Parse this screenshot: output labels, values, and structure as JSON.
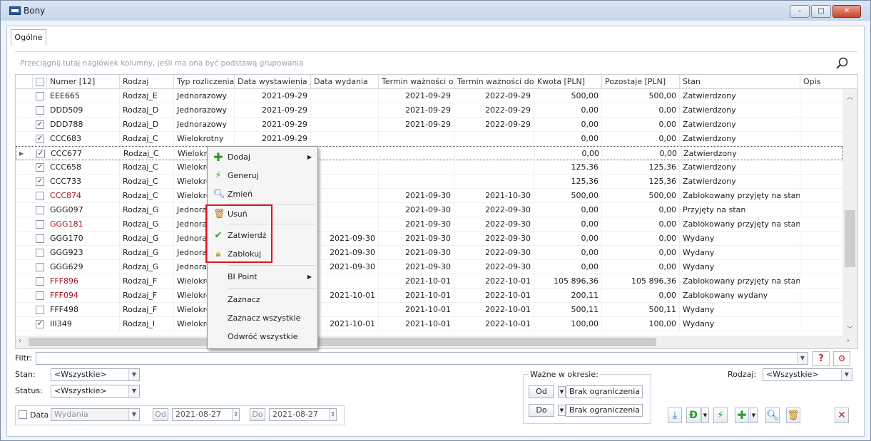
{
  "window": {
    "title": "Bony"
  },
  "tabs": [
    {
      "label": "Ogólne"
    }
  ],
  "group_hint": "Przeciągnij tutaj nagłówek kolumny, jeśli ma ona być podstawą grupowania",
  "columns": [
    "Numer [12]",
    "Rodzaj",
    "Typ rozliczenia",
    "Data wystawienia",
    "Data wydania",
    "Termin ważności od",
    "Termin ważności do",
    "Kwota [PLN]",
    "Pozostaje [PLN]",
    "Stan",
    "Opis"
  ],
  "sort_indicator": "▲",
  "rows": [
    {
      "checked": false,
      "numer": "EEE665",
      "rodzaj": "Rodzaj_E",
      "typ": "Jednorazowy",
      "data_wyst": "2021-09-29",
      "data_wyd": "",
      "od": "2021-09-29",
      "do": "2022-09-29",
      "kwota": "500,00",
      "pozostaje": "500,00",
      "stan": "Zatwierdzony",
      "red": false
    },
    {
      "checked": false,
      "numer": "DDD509",
      "rodzaj": "Rodzaj_D",
      "typ": "Jednorazowy",
      "data_wyst": "2021-09-29",
      "data_wyd": "",
      "od": "2021-09-29",
      "do": "2022-09-29",
      "kwota": "0,00",
      "pozostaje": "0,00",
      "stan": "Zatwierdzony",
      "red": false
    },
    {
      "checked": true,
      "numer": "DDD788",
      "rodzaj": "Rodzaj_D",
      "typ": "Jednorazowy",
      "data_wyst": "2021-09-29",
      "data_wyd": "",
      "od": "2021-09-29",
      "do": "2022-09-29",
      "kwota": "0,00",
      "pozostaje": "0,00",
      "stan": "Zatwierdzony",
      "red": false
    },
    {
      "checked": true,
      "numer": "CCC683",
      "rodzaj": "Rodzaj_C",
      "typ": "Wielokrotny",
      "data_wyst": "2021-09-29",
      "data_wyd": "",
      "od": "",
      "do": "",
      "kwota": "0,00",
      "pozostaje": "0,00",
      "stan": "Zatwierdzony",
      "red": false
    },
    {
      "checked": true,
      "numer": "CCC677",
      "rodzaj": "Rodzaj_C",
      "typ": "Wielokro",
      "data_wyst": "",
      "data_wyd": "",
      "od": "",
      "do": "",
      "kwota": "0,00",
      "pozostaje": "0,00",
      "stan": "Zatwierdzony",
      "red": false,
      "current": true
    },
    {
      "checked": true,
      "numer": "CCC658",
      "rodzaj": "Rodzaj_C",
      "typ": "Wielokro",
      "data_wyst": "",
      "data_wyd": "",
      "od": "",
      "do": "",
      "kwota": "125,36",
      "pozostaje": "125,36",
      "stan": "Zatwierdzony",
      "red": false
    },
    {
      "checked": true,
      "numer": "CCC733",
      "rodzaj": "Rodzaj_C",
      "typ": "Wielokro",
      "data_wyst": "",
      "data_wyd": "",
      "od": "",
      "do": "",
      "kwota": "125,36",
      "pozostaje": "125,36",
      "stan": "Zatwierdzony",
      "red": false
    },
    {
      "checked": false,
      "numer": "CCC874",
      "rodzaj": "Rodzaj_C",
      "typ": "Wielokro",
      "data_wyst": "",
      "data_wyd": "",
      "od": "2021-09-30",
      "do": "2021-10-30",
      "kwota": "500,00",
      "pozostaje": "500,00",
      "stan": "Zablokowany przyjęty na stan",
      "red": true
    },
    {
      "checked": false,
      "numer": "GGG097",
      "rodzaj": "Rodzaj_G",
      "typ": "Jednora",
      "data_wyst": "",
      "data_wyd": "",
      "od": "2021-09-30",
      "do": "2022-09-30",
      "kwota": "0,00",
      "pozostaje": "0,00",
      "stan": "Przyjęty na stan",
      "red": false
    },
    {
      "checked": false,
      "numer": "GGG181",
      "rodzaj": "Rodzaj_G",
      "typ": "Jednora",
      "data_wyst": "",
      "data_wyd": "",
      "od": "2021-09-30",
      "do": "2022-09-30",
      "kwota": "0,00",
      "pozostaje": "0,00",
      "stan": "Zablokowany przyjęty na stan",
      "red": true
    },
    {
      "checked": false,
      "numer": "GGG170",
      "rodzaj": "Rodzaj_G",
      "typ": "Jednora",
      "data_wyst": "",
      "data_wyd": "2021-09-30",
      "od": "2021-09-30",
      "do": "2022-09-30",
      "kwota": "0,00",
      "pozostaje": "0,00",
      "stan": "Wydany",
      "red": false
    },
    {
      "checked": false,
      "numer": "GGG923",
      "rodzaj": "Rodzaj_G",
      "typ": "Jednora",
      "data_wyst": "",
      "data_wyd": "2021-09-30",
      "od": "2021-09-30",
      "do": "2022-09-30",
      "kwota": "0,00",
      "pozostaje": "0,00",
      "stan": "Wydany",
      "red": false
    },
    {
      "checked": false,
      "numer": "GGG629",
      "rodzaj": "Rodzaj_G",
      "typ": "Jednora",
      "data_wyst": "",
      "data_wyd": "2021-09-30",
      "od": "2021-09-30",
      "do": "2022-09-30",
      "kwota": "0,00",
      "pozostaje": "0,00",
      "stan": "Wydany",
      "red": false
    },
    {
      "checked": false,
      "numer": "FFF896",
      "rodzaj": "Rodzaj_F",
      "typ": "Wielokro",
      "data_wyst": "",
      "data_wyd": "",
      "od": "2021-10-01",
      "do": "2022-10-01",
      "kwota": "105 896,36",
      "pozostaje": "105 896,36",
      "stan": "Zablokowany przyjęty na stan",
      "red": true
    },
    {
      "checked": false,
      "numer": "FFF094",
      "rodzaj": "Rodzaj_F",
      "typ": "Wielokro",
      "data_wyst": "",
      "data_wyd": "2021-10-01",
      "od": "2021-10-01",
      "do": "2022-10-01",
      "kwota": "200,11",
      "pozostaje": "0,00",
      "stan": "Zablokowany wydany",
      "red": true
    },
    {
      "checked": false,
      "numer": "FFF498",
      "rodzaj": "Rodzaj_F",
      "typ": "Wielokro",
      "data_wyst": "",
      "data_wyd": "",
      "od": "2021-10-01",
      "do": "2022-10-01",
      "kwota": "500,11",
      "pozostaje": "500,11",
      "stan": "Wydany",
      "red": false
    },
    {
      "checked": true,
      "numer": "III349",
      "rodzaj": "Rodzaj_I",
      "typ": "Wielokro",
      "data_wyst": "",
      "data_wyd": "2021-10-01",
      "od": "2021-10-01",
      "do": "2022-10-01",
      "kwota": "100,00",
      "pozostaje": "100,00",
      "stan": "Wydany",
      "red": false
    }
  ],
  "context_menu": [
    {
      "label": "Dodaj",
      "icon": "plus-icon",
      "submenu": true
    },
    {
      "label": "Generuj",
      "icon": "lightning-icon"
    },
    {
      "label": "Zmień",
      "icon": "magnifier-icon"
    },
    {
      "label": "Usuń",
      "icon": "trash-icon"
    },
    {
      "label": "Zatwierdź",
      "icon": "check-icon"
    },
    {
      "label": "Zablokuj",
      "icon": "lock-icon"
    },
    {
      "label": "BI Point",
      "submenu": true
    },
    {
      "label": "Zaznacz"
    },
    {
      "label": "Zaznacz wszystkie"
    },
    {
      "label": "Odwróć wszystkie"
    }
  ],
  "filters": {
    "filtr_label": "Filtr:",
    "stan_label": "Stan:",
    "stan_value": "<Wszystkie>",
    "status_label": "Status:",
    "status_value": "<Wszystkie>",
    "data_label": "Data",
    "data_type_value": "Wydania",
    "od_label": "Od",
    "od_value": "2021-08-27",
    "do_label": "Do",
    "do_value": "2021-08-27",
    "wazne_label": "Ważne w okresie:",
    "wazne_od_label": "Od",
    "wazne_od_value": "Brak ograniczenia",
    "wazne_do_label": "Do",
    "wazne_do_value": "Brak ograniczenia",
    "rodzaj_label": "Rodzaj:",
    "rodzaj_value": "<Wszystkie>"
  },
  "colors": {
    "accent_red": "#e0141c",
    "blocked_text": "#a8131a",
    "add_green": "#2e9a2e"
  }
}
